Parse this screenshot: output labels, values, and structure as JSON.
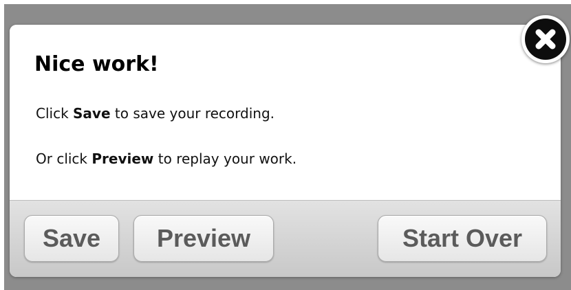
{
  "dialog": {
    "title": "Nice work!",
    "line1": {
      "prefix": "Click ",
      "bold": "Save",
      "suffix": " to save your recording."
    },
    "line2": {
      "prefix": "Or click ",
      "bold": "Preview",
      "suffix": " to replay your work."
    }
  },
  "buttons": {
    "save_label": "Save",
    "preview_label": "Preview",
    "start_over_label": "Start Over"
  },
  "icons": {
    "close": "close-icon"
  },
  "colors": {
    "overlay": "#8c8c8c",
    "button_text": "#5b5b5b",
    "close_bg": "#0d0d0d"
  }
}
